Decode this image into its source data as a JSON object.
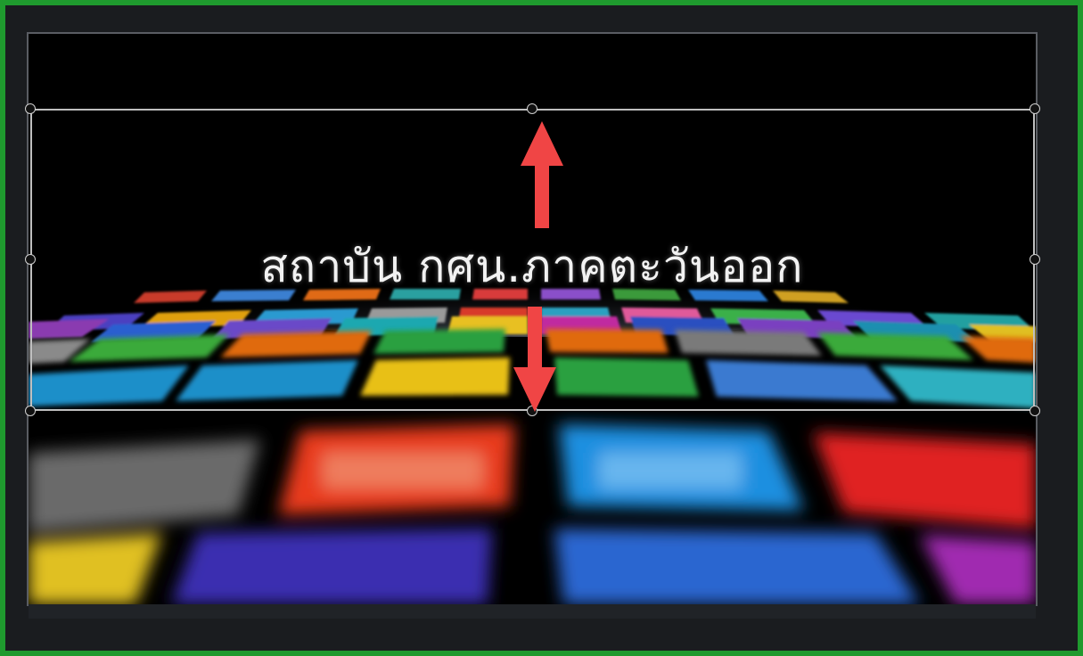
{
  "text_overlay": {
    "title": "สถาบัน กศน.ภาคตะวันออก"
  },
  "colors": {
    "frame_border": "#1f9a2e",
    "arrow": "#f04545",
    "selection_box": "#bfbfbf"
  },
  "icons": {
    "arrow_up": "arrow-up-icon",
    "arrow_down": "arrow-down-icon"
  }
}
